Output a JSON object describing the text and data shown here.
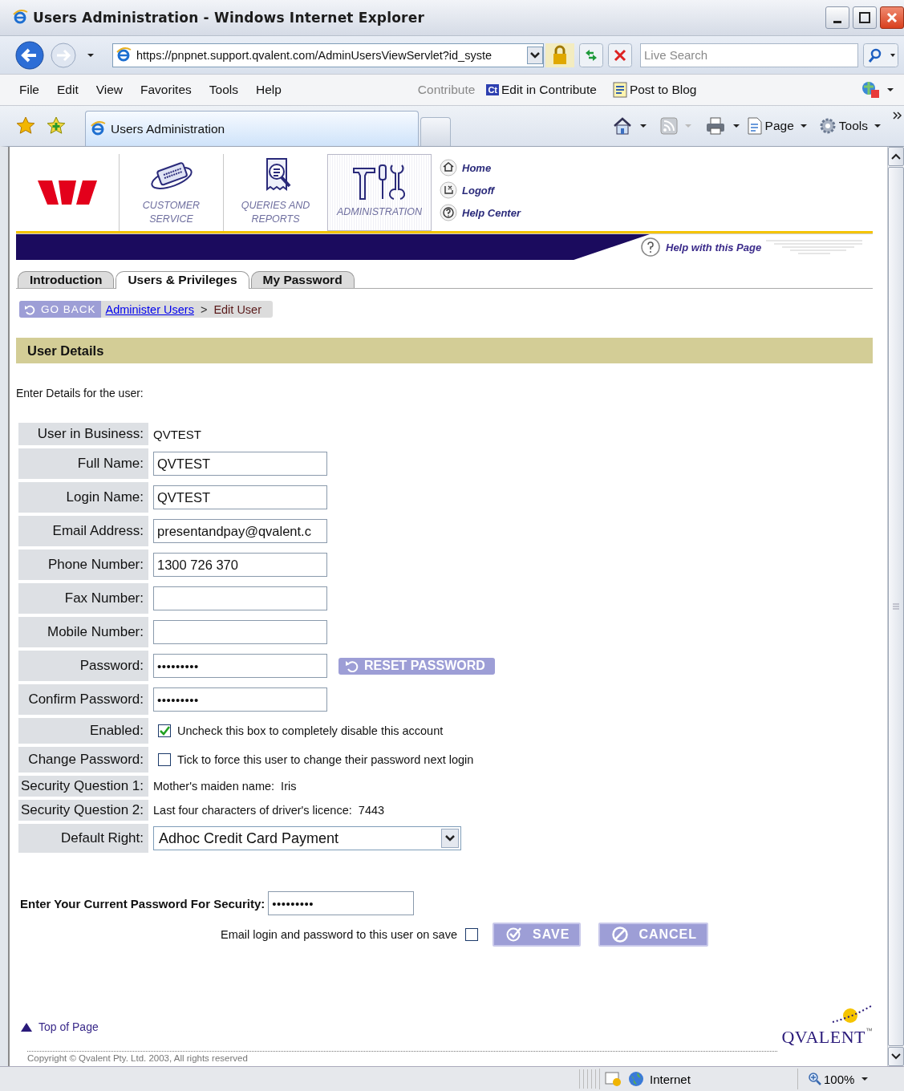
{
  "window": {
    "title": "Users Administration - Windows Internet Explorer"
  },
  "address_bar": {
    "url": "https://pnpnet.support.qvalent.com/AdminUsersViewServlet?id_syste",
    "search": {
      "placeholder": "Live Search"
    }
  },
  "menu": {
    "items": [
      "File",
      "Edit",
      "View",
      "Favorites",
      "Tools",
      "Help"
    ],
    "contribute": "Contribute",
    "contribute_badge": "Ct",
    "edit_in_contribute": "Edit in Contribute",
    "post_to_blog": "Post to Blog"
  },
  "browser_tab": {
    "title": "Users Administration"
  },
  "command_bar": {
    "page": "Page",
    "tools": "Tools"
  },
  "site_nav": [
    {
      "label": "CUSTOMER SERVICE",
      "selected": false
    },
    {
      "label": "QUERIES AND REPORTS",
      "selected": false
    },
    {
      "label": "ADMINISTRATION",
      "selected": true
    }
  ],
  "quick_links": [
    "Home",
    "Logoff",
    "Help Center"
  ],
  "help_link": "Help with this Page",
  "tabs": [
    {
      "label": "Introduction",
      "selected": false
    },
    {
      "label": "Users & Privileges",
      "selected": true
    },
    {
      "label": "My Password",
      "selected": false
    }
  ],
  "breadcrumb": {
    "back": "GO BACK",
    "link": "Administer Users",
    "separator": ">",
    "current": "Edit User"
  },
  "section": {
    "title": "User Details",
    "intro": "Enter Details for the user:"
  },
  "fields": [
    {
      "kind": "static",
      "label": "User in Business:",
      "value": "QVTEST"
    },
    {
      "kind": "input",
      "label": "Full Name:",
      "value": "QVTEST"
    },
    {
      "kind": "input",
      "label": "Login Name:",
      "value": "QVTEST"
    },
    {
      "kind": "input",
      "label": "Email Address:",
      "value": "presentandpay@qvalent.c"
    },
    {
      "kind": "input",
      "label": "Phone Number:",
      "value": "1300 726 370"
    },
    {
      "kind": "input",
      "label": "Fax Number:"
    },
    {
      "kind": "input",
      "label": "Mobile Number:"
    },
    {
      "kind": "password",
      "label": "Password:",
      "value": "•••••••••",
      "action": "RESET PASSWORD"
    },
    {
      "kind": "password",
      "label": "Confirm Password:",
      "value": "•••••••••"
    },
    {
      "kind": "checkbox",
      "label": "Enabled:",
      "checked": true,
      "text": "Uncheck this box to completely disable this account"
    },
    {
      "kind": "checkbox",
      "label": "Change Password:",
      "checked": false,
      "text": "Tick to force this user to change their password next login"
    },
    {
      "kind": "note",
      "label": "Security Question 1:",
      "value": "Mother's maiden name:  Iris"
    },
    {
      "kind": "note",
      "label": "Security Question 2:",
      "value": "Last four characters of driver's licence:  7443"
    },
    {
      "kind": "select",
      "label": "Default Right:",
      "value": "Adhoc Credit Card Payment"
    }
  ],
  "current_password": {
    "label": "Enter Your Current Password For Security:",
    "value": "•••••••••"
  },
  "email_on_save": {
    "label": "Email login and password to this user on save",
    "checked": false
  },
  "buttons": [
    {
      "label": "SAVE",
      "kind": "save"
    },
    {
      "label": "CANCEL",
      "kind": "cancel"
    }
  ],
  "footer": {
    "top_link": "Top of Page",
    "copyright": "Copyright © Qvalent Pty. Ltd. 2003, All rights reserved",
    "brand": "QVALENT",
    "trademark": "™"
  },
  "status_bar": {
    "zone": "Internet",
    "zoom": "100%"
  }
}
